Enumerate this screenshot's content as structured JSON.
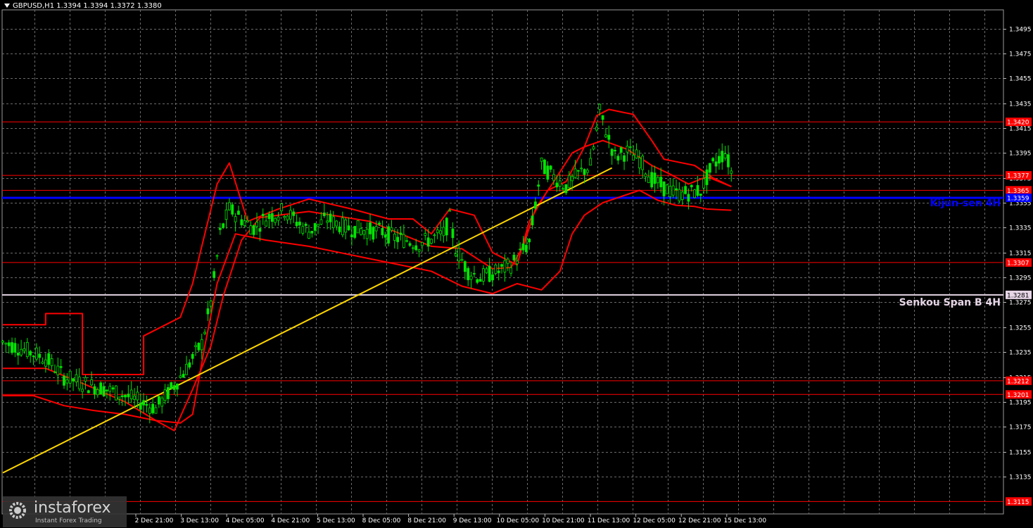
{
  "header": {
    "symbol_line": "GBPUSD,H1  1.3394  1.3394  1.3372  1.3380"
  },
  "watermark": {
    "brand": "instaforex",
    "tagline": "Instant Forex Trading"
  },
  "chart_data": {
    "type": "candlestick",
    "title": "GBPUSD,H1",
    "ylim": [
      1.3105,
      1.351
    ],
    "y_ticks": [
      "1.3495",
      "1.3475",
      "1.3455",
      "1.3435",
      "1.3415",
      "1.3395",
      "1.3375",
      "1.3355",
      "1.3335",
      "1.3315",
      "1.3295",
      "1.3275",
      "1.3255",
      "1.3235",
      "1.3215",
      "1.3195",
      "1.3175",
      "1.3155",
      "1.3135"
    ],
    "x_ticks": [
      "2 Dec 21:00",
      "3 Dec 13:00",
      "4 Dec 05:00",
      "4 Dec 21:00",
      "5 Dec 13:00",
      "8 Dec 05:00",
      "8 Dec 21:00",
      "9 Dec 13:00",
      "10 Dec 05:00",
      "10 Dec 21:00",
      "11 Dec 13:00",
      "12 Dec 05:00",
      "12 Dec 21:00",
      "15 Dec 13:00"
    ],
    "grid": true,
    "last_ohlc": {
      "open": 1.3394,
      "high": 1.3394,
      "low": 1.3372,
      "close": 1.338
    },
    "horizontal_levels": [
      {
        "price": 1.342,
        "label": "1.3420",
        "color": "#ff0000"
      },
      {
        "price": 1.3377,
        "label": "1.3377",
        "color": "#ff0000"
      },
      {
        "price": 1.3365,
        "label": "1.3365",
        "color": "#ff0000"
      },
      {
        "price": 1.3359,
        "label": "1.3359",
        "color": "#0000ff"
      },
      {
        "price": 1.3307,
        "label": "1.3307",
        "color": "#ff0000"
      },
      {
        "price": 1.3281,
        "label": "1.3281",
        "color": "#e6d6e6"
      },
      {
        "price": 1.3212,
        "label": "1.3212",
        "color": "#ff0000"
      },
      {
        "price": 1.3201,
        "label": "1.3201",
        "color": "#ff0000"
      },
      {
        "price": 1.3115,
        "label": "1.3115",
        "color": "#ff0000"
      }
    ],
    "annotations": [
      {
        "text": "Kijun-sen 4H",
        "color": "#0000ff"
      },
      {
        "text": "Senkou Span B 4H",
        "color": "#e6d6e6"
      }
    ],
    "trendline": {
      "color": "#ffd700",
      "points": [
        {
          "bar": 0,
          "price": 1.3138
        },
        {
          "bar": 199,
          "price": 1.3383
        }
      ]
    },
    "price_path": [
      [
        0,
        1.3243
      ],
      [
        6,
        1.3238
      ],
      [
        14,
        1.323
      ],
      [
        20,
        1.3215
      ],
      [
        26,
        1.321
      ],
      [
        34,
        1.3205
      ],
      [
        40,
        1.32
      ],
      [
        45,
        1.3195
      ],
      [
        50,
        1.319
      ],
      [
        55,
        1.3205
      ],
      [
        60,
        1.3222
      ],
      [
        65,
        1.3242
      ],
      [
        68,
        1.3275
      ],
      [
        71,
        1.333
      ],
      [
        74,
        1.335
      ],
      [
        78,
        1.3342
      ],
      [
        82,
        1.3335
      ],
      [
        86,
        1.3343
      ],
      [
        92,
        1.3349
      ],
      [
        96,
        1.334
      ],
      [
        100,
        1.3332
      ],
      [
        106,
        1.3342
      ],
      [
        112,
        1.3335
      ],
      [
        118,
        1.3333
      ],
      [
        124,
        1.3332
      ],
      [
        128,
        1.3327
      ],
      [
        132,
        1.3325
      ],
      [
        136,
        1.3322
      ],
      [
        140,
        1.3326
      ],
      [
        144,
        1.333
      ],
      [
        146,
        1.3342
      ],
      [
        148,
        1.3318
      ],
      [
        152,
        1.33
      ],
      [
        156,
        1.3295
      ],
      [
        162,
        1.33
      ],
      [
        166,
        1.3305
      ],
      [
        172,
        1.3323
      ],
      [
        176,
        1.3385
      ],
      [
        180,
        1.3376
      ],
      [
        184,
        1.3368
      ],
      [
        188,
        1.3378
      ],
      [
        192,
        1.3385
      ],
      [
        195,
        1.3428
      ],
      [
        197,
        1.3413
      ],
      [
        200,
        1.3392
      ],
      [
        204,
        1.3396
      ],
      [
        208,
        1.339
      ],
      [
        212,
        1.3374
      ],
      [
        216,
        1.3367
      ],
      [
        220,
        1.3362
      ],
      [
        224,
        1.3363
      ],
      [
        228,
        1.3365
      ],
      [
        232,
        1.3385
      ],
      [
        236,
        1.3396
      ],
      [
        238,
        1.338
      ]
    ],
    "indicator_lines": [
      {
        "name": "",
        "color": "#ff0000",
        "points": [
          [
            0,
            1.3257
          ],
          [
            14,
            1.3257
          ],
          [
            14,
            1.3266
          ],
          [
            26,
            1.3266
          ],
          [
            26,
            1.3217
          ],
          [
            46,
            1.3217
          ],
          [
            46,
            1.3248
          ],
          [
            58,
            1.3263
          ],
          [
            62,
            1.329
          ],
          [
            66,
            1.333
          ],
          [
            70,
            1.337
          ],
          [
            74,
            1.3387
          ],
          [
            80,
            1.334
          ],
          [
            90,
            1.335
          ],
          [
            100,
            1.3358
          ],
          [
            114,
            1.335
          ],
          [
            126,
            1.3342
          ],
          [
            134,
            1.3342
          ],
          [
            140,
            1.333
          ],
          [
            146,
            1.335
          ],
          [
            154,
            1.3345
          ],
          [
            160,
            1.3315
          ],
          [
            168,
            1.3305
          ],
          [
            172,
            1.334
          ],
          [
            178,
            1.3365
          ],
          [
            184,
            1.3372
          ],
          [
            190,
            1.34
          ],
          [
            194,
            1.3425
          ],
          [
            198,
            1.343
          ],
          [
            202,
            1.3428
          ],
          [
            206,
            1.3426
          ],
          [
            212,
            1.3405
          ],
          [
            216,
            1.339
          ],
          [
            220,
            1.3388
          ],
          [
            226,
            1.3385
          ],
          [
            232,
            1.3375
          ],
          [
            238,
            1.3368
          ]
        ]
      },
      {
        "name": "",
        "color": "#ff0000",
        "points": [
          [
            0,
            1.3222
          ],
          [
            14,
            1.3222
          ],
          [
            26,
            1.321
          ],
          [
            40,
            1.3195
          ],
          [
            50,
            1.318
          ],
          [
            56,
            1.3172
          ],
          [
            62,
            1.3205
          ],
          [
            68,
            1.324
          ],
          [
            72,
            1.328
          ],
          [
            78,
            1.3325
          ],
          [
            84,
            1.3343
          ],
          [
            90,
            1.3345
          ],
          [
            100,
            1.3348
          ],
          [
            120,
            1.334
          ],
          [
            140,
            1.332
          ],
          [
            150,
            1.3318
          ],
          [
            160,
            1.3302
          ],
          [
            166,
            1.3303
          ],
          [
            170,
            1.332
          ],
          [
            174,
            1.335
          ],
          [
            180,
            1.3372
          ],
          [
            186,
            1.3395
          ],
          [
            190,
            1.34
          ],
          [
            196,
            1.3405
          ],
          [
            204,
            1.3398
          ],
          [
            212,
            1.3385
          ],
          [
            218,
            1.3378
          ],
          [
            224,
            1.337
          ],
          [
            230,
            1.3376
          ],
          [
            238,
            1.3368
          ]
        ]
      },
      {
        "name": "",
        "color": "#ff0000",
        "points": [
          [
            0,
            1.32
          ],
          [
            10,
            1.32
          ],
          [
            20,
            1.3192
          ],
          [
            30,
            1.3188
          ],
          [
            40,
            1.3185
          ],
          [
            50,
            1.318
          ],
          [
            58,
            1.3178
          ],
          [
            62,
            1.3185
          ],
          [
            66,
            1.324
          ],
          [
            70,
            1.329
          ],
          [
            76,
            1.333
          ],
          [
            86,
            1.3325
          ],
          [
            100,
            1.332
          ],
          [
            120,
            1.331
          ],
          [
            140,
            1.33
          ],
          [
            150,
            1.3288
          ],
          [
            160,
            1.3282
          ],
          [
            168,
            1.329
          ],
          [
            176,
            1.3285
          ],
          [
            182,
            1.33
          ],
          [
            186,
            1.333
          ],
          [
            190,
            1.3345
          ],
          [
            196,
            1.3355
          ],
          [
            202,
            1.336
          ],
          [
            208,
            1.3365
          ],
          [
            214,
            1.3357
          ],
          [
            220,
            1.3353
          ],
          [
            226,
            1.3352
          ],
          [
            230,
            1.335
          ],
          [
            238,
            1.3349
          ]
        ]
      }
    ]
  }
}
